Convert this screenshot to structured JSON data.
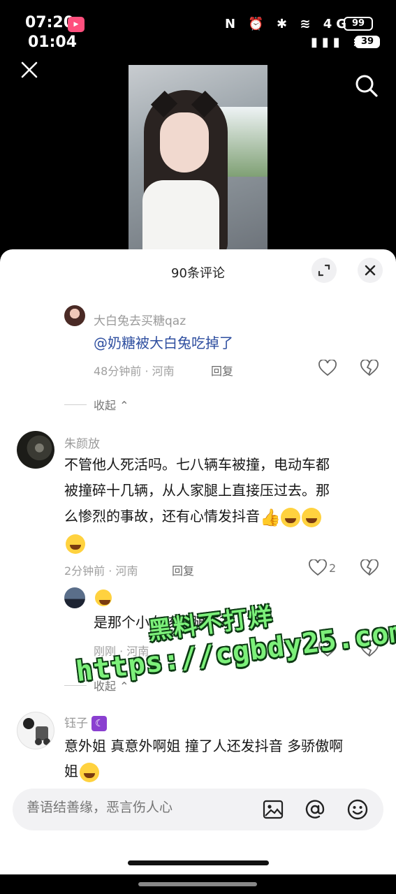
{
  "status_bar": {
    "time_primary": "07:20",
    "time_secondary": "01:04",
    "app_badge": "bilibili",
    "icons_row1": "N ⏰ ✱ ≋ 4G",
    "icons_row2": "▮▮▮ ≋",
    "battery_primary": "99",
    "battery_secondary": "39"
  },
  "comments_panel": {
    "title": "90条评论"
  },
  "comments": [
    {
      "username": "大白兔去买糖qaz",
      "mention": "@奶糖被大白兔吃掉了",
      "meta": "48分钟前 · 河南",
      "reply_label": "回复"
    }
  ],
  "collapse_label_1": "收起",
  "comment2": {
    "username": "朱颜放",
    "text_line1": "不管他人死活吗。七八辆车被撞，电动车都",
    "text_line2": "被撞碎十几辆，从人家腿上直接压过去。那",
    "text_line3": "么惨烈的事故，还有心情发抖音",
    "meta": "2分钟前 · 河南",
    "reply_label": "回复",
    "like_count": "2"
  },
  "reply2": {
    "text": "是那个小女孩的腿不?",
    "meta": "刚刚 · 河南"
  },
  "collapse_label_2": "收起",
  "comment3": {
    "username": "钰子",
    "text_line1": "意外姐 真意外啊姐 撞了人还发抖音 多骄傲啊",
    "text_line2": "姐"
  },
  "input": {
    "placeholder": "善语结善缘，恶言伤人心"
  },
  "watermark": {
    "line1": "黑料不打烊",
    "line2": "https://cgbdy25.com"
  },
  "colors": {
    "mention": "#2f4fa0",
    "watermark": "#7cf07a"
  }
}
